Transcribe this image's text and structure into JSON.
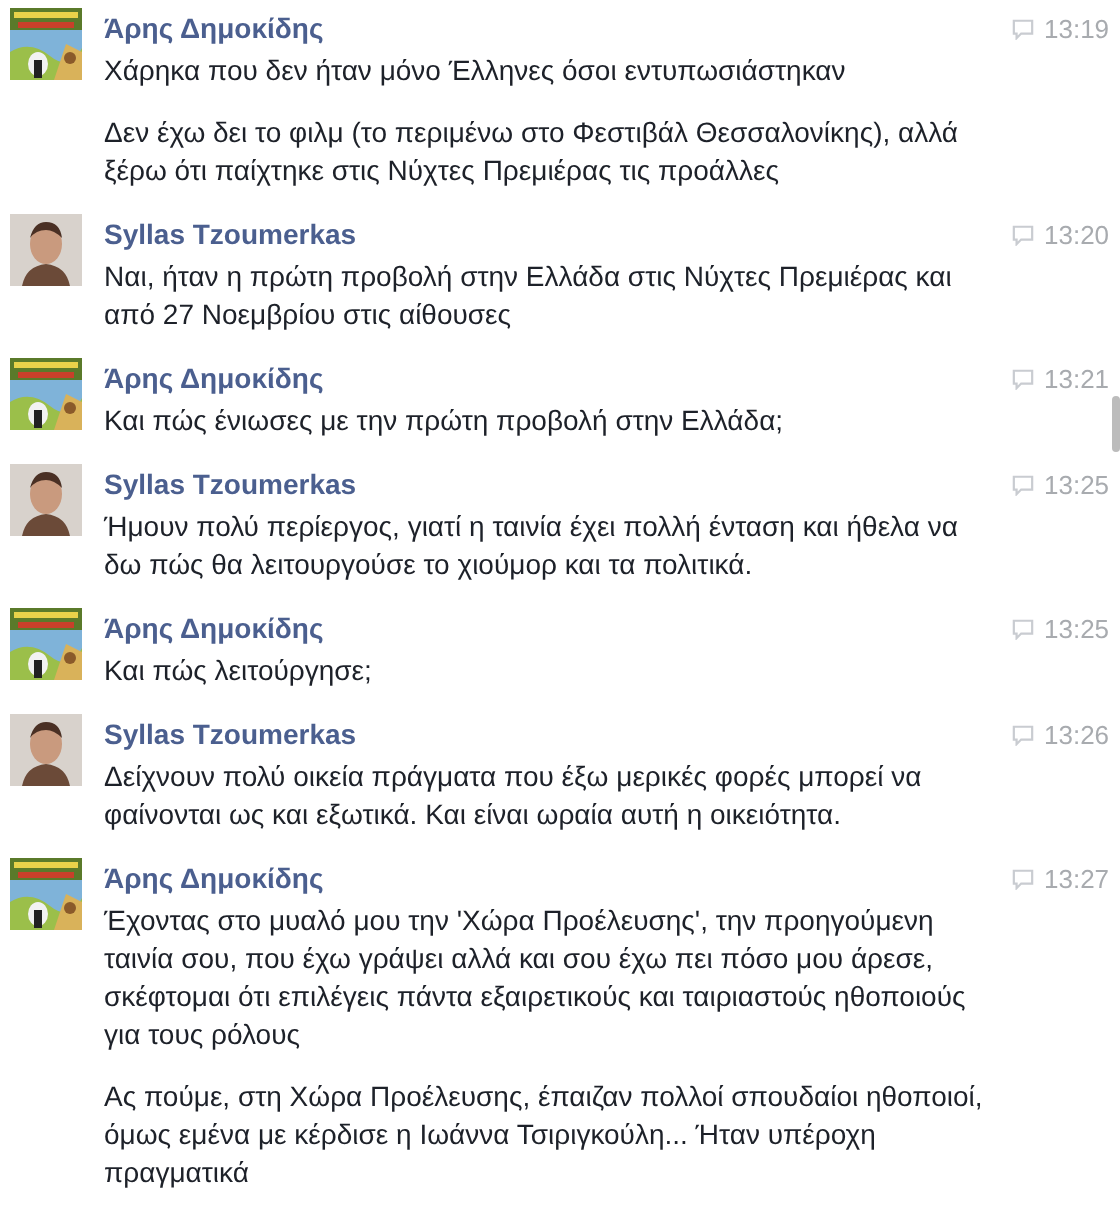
{
  "messages": [
    {
      "kind": "cartoon",
      "sender": "Άρης Δημοκίδης",
      "time": "13:19",
      "texts": [
        "Χάρηκα που δεν ήταν μόνο Έλληνες όσοι εντυπωσιάστηκαν",
        "Δεν έχω δει το φιλμ (το περιμένω στο Φεστιβάλ Θεσσαλονίκης), αλλά ξέρω ότι παίχτηκε στις Νύχτες Πρεμιέρας τις προάλλες"
      ]
    },
    {
      "sender": "Syllas Tzoumerkas",
      "time": "13:20",
      "texts": [
        "Ναι, ήταν η πρώτη προβολή στην Ελλάδα στις Νύχτες Πρεμιέρας και από 27 Νοεμβρίου στις αίθουσες"
      ]
    },
    {
      "kind": "cartoon",
      "sender": "Άρης Δημοκίδης",
      "time": "13:21",
      "texts": [
        "Και πώς ένιωσες με την πρώτη προβολή στην Ελλάδα;"
      ]
    },
    {
      "sender": "Syllas Tzoumerkas",
      "time": "13:25",
      "texts": [
        "Ήμουν πολύ περίεργος, γιατί η ταινία έχει πολλή ένταση  και ήθελα να δω πώς θα λειτουργούσε το χιούμορ και τα πολιτικά."
      ]
    },
    {
      "kind": "cartoon",
      "sender": "Άρης Δημοκίδης",
      "time": "13:25",
      "texts": [
        "Και πώς λειτούργησε;"
      ]
    },
    {
      "sender": "Syllas Tzoumerkas",
      "time": "13:26",
      "texts": [
        "Δείχνουν πολύ οικεία πράγματα που έξω μερικές φορές μπορεί να φαίνονται ως και εξωτικά. Και είναι ωραία αυτή η οικειότητα."
      ]
    },
    {
      "kind": "cartoon",
      "sender": "Άρης Δημοκίδης",
      "time": "13:27",
      "texts": [
        "Έχοντας στο μυαλό μου την 'Χώρα Προέλευσης', την προηγούμενη ταινία σου, που έχω γράψει αλλά και σου έχω πει πόσο μου άρεσε, σκέφτομαι ότι επιλέγεις πάντα εξαιρετικούς και ταιριαστούς ηθοποιούς για τους ρόλους",
        "Ας πούμε, στη Χώρα Προέλευσης, έπαιζαν πολλοί σπουδαίοι ηθοποιοί, όμως εμένα με κέρδισε η Ιωάννα Τσιριγκούλη... Ήταν υπέροχη πραγματικά"
      ]
    }
  ]
}
